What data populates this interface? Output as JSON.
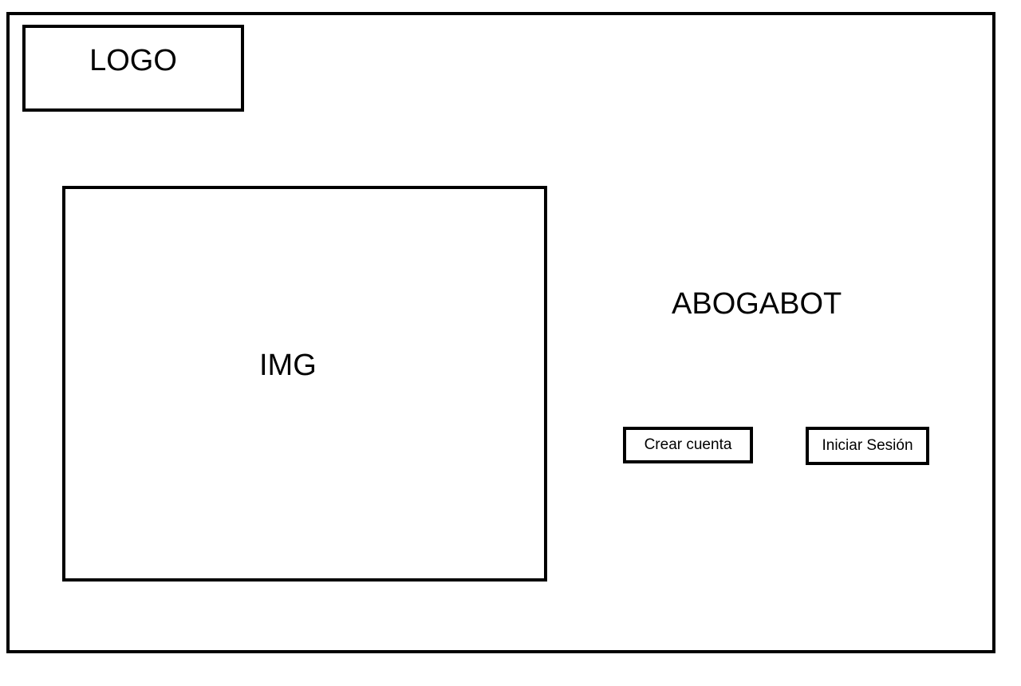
{
  "header": {
    "logo_label": "LOGO"
  },
  "hero": {
    "image_label": "IMG"
  },
  "brand": {
    "title": "ABOGABOT"
  },
  "actions": {
    "create_account_label": "Crear cuenta",
    "login_label": "Iniciar Sesión"
  },
  "colors": {
    "stroke": "#000000",
    "background": "#ffffff"
  }
}
